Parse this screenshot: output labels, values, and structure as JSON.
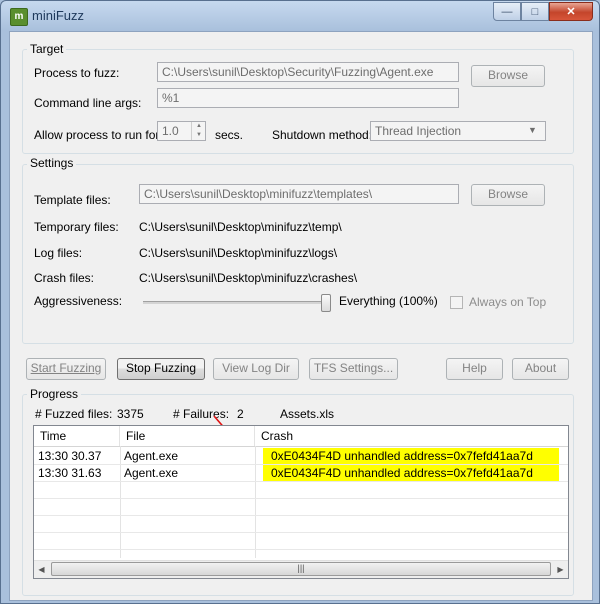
{
  "window": {
    "title": "miniFuzz",
    "icon": "minifuzz-app-icon",
    "controls": [
      "minimize-icon",
      "maximize-icon",
      "close-icon"
    ]
  },
  "target": {
    "group_label": "Target",
    "process_label": "Process to fuzz:",
    "process_value": "C:\\Users\\sunil\\Desktop\\Security\\Fuzzing\\Agent.exe",
    "browse_label": "Browse",
    "args_label": "Command line args:",
    "args_value": "%1",
    "runtime_label": "Allow process to run for:",
    "runtime_value": "1.0",
    "runtime_unit": "secs.",
    "shutdown_label": "Shutdown method:",
    "shutdown_value": "Thread Injection"
  },
  "settings": {
    "group_label": "Settings",
    "template_label": "Template files:",
    "template_value": "C:\\Users\\sunil\\Desktop\\minifuzz\\templates\\",
    "browse_label": "Browse",
    "temp_label": "Temporary files:",
    "temp_value": "C:\\Users\\sunil\\Desktop\\minifuzz\\temp\\",
    "log_label": "Log files:",
    "log_value": "C:\\Users\\sunil\\Desktop\\minifuzz\\logs\\",
    "crash_label": "Crash files:",
    "crash_value": "C:\\Users\\sunil\\Desktop\\minifuzz\\crashes\\",
    "aggr_label": "Aggressiveness:",
    "aggr_value_text": "Everything (100%)",
    "aggr_level": 1.0,
    "always_on_top_label": "Always on Top",
    "always_on_top_checked": false
  },
  "buttons": {
    "start": "Start Fuzzing",
    "stop": "Stop Fuzzing",
    "view_log": "View Log Dir",
    "tfs": "TFS Settings...",
    "help": "Help",
    "about": "About"
  },
  "progress": {
    "group_label": "Progress",
    "fuzzed_label": "# Fuzzed files:",
    "fuzzed_value": "3375",
    "failures_label": "# Failures:",
    "failures_value": "2",
    "current_file": "Assets.xls",
    "columns": [
      "Time",
      "File",
      "Crash"
    ],
    "rows": [
      {
        "time": "13:30 30.37",
        "file": "Agent.exe",
        "crash": "0xE0434F4D unhandled address=0x7fefd41aa7d"
      },
      {
        "time": "13:30 31.63",
        "file": "Agent.exe",
        "crash": "0xE0434F4D unhandled address=0x7fefd41aa7d"
      }
    ],
    "scroll_grip": "|||"
  },
  "colors": {
    "highlight": "#ffff00",
    "arrow": "#e01010"
  }
}
